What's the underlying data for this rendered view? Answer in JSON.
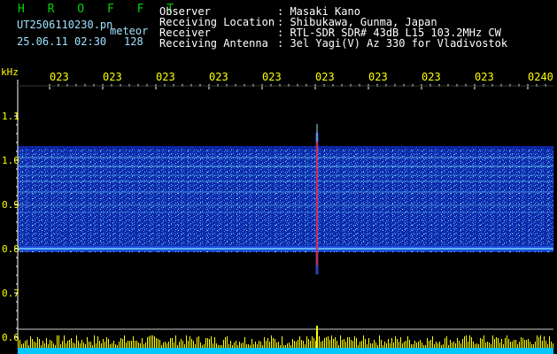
{
  "header": {
    "title_text": "H R O F F T",
    "filename": "UT2506110230.pn",
    "mode": "meteor",
    "datetime": "25.06.11 02:30",
    "count": "128",
    "observer_label": "Observer",
    "observer_value": ": Masaki Kano",
    "location_label": "Receiving Location",
    "location_value": ": Shibukawa, Gunma, Japan",
    "receiver_label": "Receiver",
    "receiver_value": ": RTL-SDR SDR# 43dB L15 103.2MHz CW",
    "antenna_label": "Receiving Antenna",
    "antenna_value": ": 3el Yagi(V) Az 330 for Vladivostok"
  },
  "axis": {
    "unit": "kHz",
    "y_ticks": [
      "1.1",
      "1.0",
      "0.9",
      "0.8",
      "0.7",
      "0.6"
    ],
    "x_ticks": [
      "023",
      "023",
      "023",
      "023",
      "023",
      "023",
      "023",
      "023",
      "023",
      "0240"
    ]
  },
  "colors": {
    "band_dark": "#0a1a9a",
    "band_mid": "#1e4fe0",
    "line_cyan": "#6fd0ff",
    "meteor_red": "#ff2020",
    "histogram_yellow": "#ffff00",
    "histogram_cyan": "#00c8ff",
    "label_yellow": "#ffff00",
    "label_green": "#00d000"
  }
}
